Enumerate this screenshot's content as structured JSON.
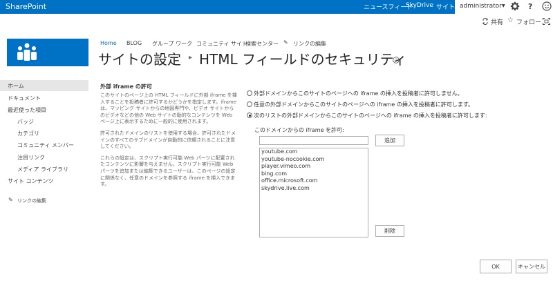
{
  "suite_bar": {
    "brand": "SharePoint",
    "links": [
      "ニュースフィード",
      "SkyDrive",
      "サイト"
    ],
    "user": "administrator"
  },
  "actions": {
    "share": "共有",
    "follow": "フォロー"
  },
  "top_nav": {
    "items": [
      "Home",
      "BLOG",
      "グループ ワーク",
      "コミュニティ サイト",
      "検索センター"
    ],
    "edit_links": "リンクの編集"
  },
  "page_title": {
    "main": "サイトの設定",
    "sub": "HTML フィールドのセキュリティ"
  },
  "quick_launch": {
    "items": [
      "ホーム",
      "ドキュメント",
      "最近使った項目",
      "バッジ",
      "カテゴリ",
      "コミュニティ メンバー",
      "注目リンク",
      "メディア ライブラリ",
      "サイト コンテンツ"
    ],
    "edit_links": "リンクの編集"
  },
  "section": {
    "title": "外部 iframe の許可",
    "paragraphs": [
      "このサイトのページ上の HTML フィールドに外部 iframe を挿入することを投稿者に許可するかどうかを指定します。iframe は、マッピング サイトからの地図専門や、ビデオ サイトからのビデオなどの他の Web サイトの動的なコンテンツを Web ページ上に表示するために一般的に使用されます。",
      "許可されたドメインのリストを使用する場合、許可されたドメインのすべてのサブドメインが自動的に信頼されることに注意してください。",
      "これらの設定は、スクリプト実行可能 Web パーツに配置されたコンテンツに影響を与えません。スクリプト実行可能 Web パーツを追加または編集できるユーザーは、このページの設定に関係なく、任意のドメインを参照する iframe を挿入できます。"
    ]
  },
  "options": [
    {
      "label": "外部ドメインからこのサイトのページへの iframe の挿入を投稿者に許可しません。",
      "checked": false
    },
    {
      "label": "任意の外部ドメインからこのサイトのページへの iframe の挿入を投稿者に許可します。",
      "checked": false
    },
    {
      "label": "次のリストの外部ドメインからこのサイトのページへの iframe の挿入を投稿者に許可します:",
      "checked": true
    }
  ],
  "domain_form": {
    "label": "このドメインからの iframe を許可:",
    "input_value": "",
    "add_label": "追加",
    "domains": [
      "youtube.com",
      "youtube-nocookie.com",
      "player.vimeo.com",
      "bing.com",
      "office.microsoft.com",
      "skydrive.live.com"
    ],
    "delete_label": "削除"
  },
  "buttons": {
    "ok": "OK",
    "cancel": "キャンセル"
  }
}
